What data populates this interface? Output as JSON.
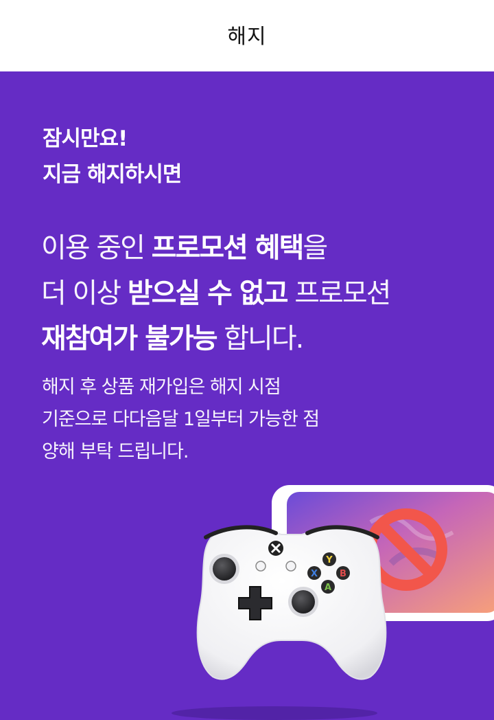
{
  "header": {
    "title": "해지"
  },
  "intro": {
    "line1": "잠시만요!",
    "line2": "지금 해지하시면"
  },
  "notice": {
    "l1_a": "이용 중인 ",
    "l1_b": "프로모션 혜택",
    "l1_c": "을",
    "l2_a": "더 이상 ",
    "l2_b": "받으실 수 없고",
    "l2_c": " 프로모션",
    "l3_a": "재참여가 불가능",
    "l3_b": " 합니다."
  },
  "sub": {
    "line1": "해지 후 상품 재가입은 해지 시점",
    "line2": "기준으로 다다음달 1일부터 가능한 점",
    "line3": "양해 부탁 드립니다."
  },
  "illustration": {
    "button_y": "Y",
    "button_b": "B",
    "button_a": "A",
    "button_x": "X",
    "icons": [
      "xbox-controller",
      "smartphone",
      "prohibited-icon"
    ],
    "colors": {
      "background": "#652CC5",
      "prohibit": "#F2564B"
    }
  }
}
